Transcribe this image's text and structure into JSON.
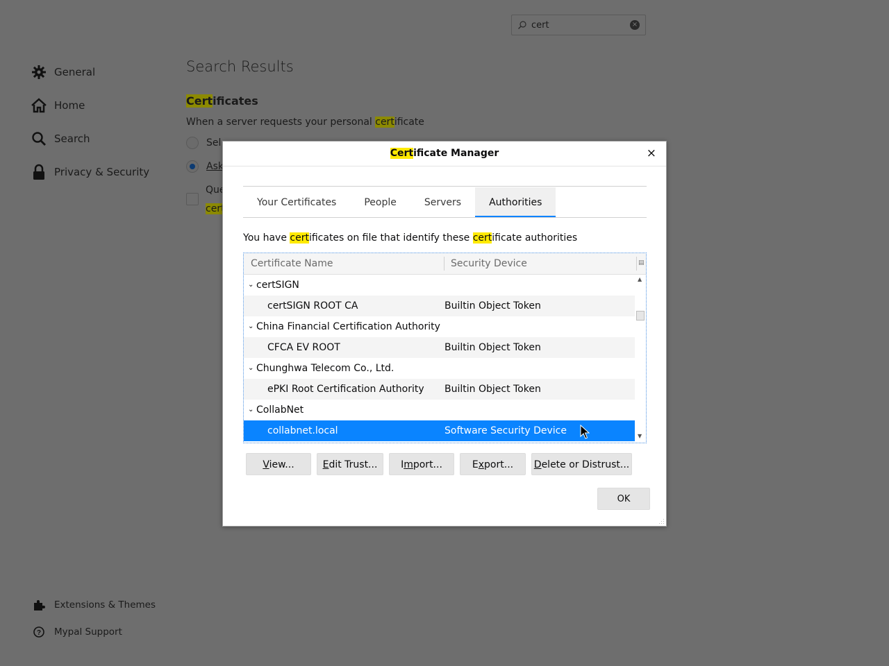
{
  "search": {
    "value": "cert",
    "clear_icon": "clear-icon"
  },
  "nav": {
    "items": [
      {
        "label": "General",
        "icon": "gear-icon"
      },
      {
        "label": "Home",
        "icon": "home-icon"
      },
      {
        "label": "Search",
        "icon": "search-icon"
      },
      {
        "label": "Privacy & Security",
        "icon": "lock-icon"
      }
    ],
    "bottom": [
      {
        "label": "Extensions & Themes",
        "icon": "puzzle-icon"
      },
      {
        "label": "Mypal Support",
        "icon": "help-icon"
      }
    ]
  },
  "results": {
    "title": "Search Results",
    "section_pre": "Cert",
    "section_post": "ificates",
    "desc_pre": "When a server requests your personal ",
    "desc_hl": "cert",
    "desc_post": "ificate",
    "peek_select": "Sel",
    "peek_ask": "Ask",
    "peek_query": "Que",
    "peek_cert": "cert"
  },
  "dialog": {
    "title_hl": "Cert",
    "title_rest": "ificate Manager",
    "close": "×",
    "tabs": [
      "Your Certificates",
      "People",
      "Servers",
      "Authorities"
    ],
    "active_tab": "Authorities",
    "intro_1": "You have ",
    "intro_hl1": "cert",
    "intro_2": "ificates on file that identify these ",
    "intro_hl2": "cert",
    "intro_3": "ificate authorities",
    "columns": [
      "Certificate Name",
      "Security Device"
    ],
    "rows": [
      {
        "type": "group",
        "name": "certSIGN"
      },
      {
        "type": "cert",
        "name": "certSIGN ROOT CA",
        "device": "Builtin Object Token"
      },
      {
        "type": "group",
        "name": "China Financial Certification Authority"
      },
      {
        "type": "cert",
        "name": "CFCA EV ROOT",
        "device": "Builtin Object Token"
      },
      {
        "type": "group",
        "name": "Chunghwa Telecom Co., Ltd."
      },
      {
        "type": "cert",
        "name": "ePKI Root Certification Authority",
        "device": "Builtin Object Token"
      },
      {
        "type": "group",
        "name": "CollabNet"
      },
      {
        "type": "cert",
        "name": "collabnet.local",
        "device": "Software Security Device",
        "selected": true
      }
    ],
    "buttons": {
      "view_u": "V",
      "view_rest": "iew...",
      "edit_u": "E",
      "edit_rest": "dit Trust...",
      "import_pre": "I",
      "import_u": "m",
      "import_rest": "port...",
      "export_u": "x",
      "export_pre": "E",
      "export_rest": "port...",
      "delete_u": "D",
      "delete_rest": "elete or Distrust...",
      "ok": "OK"
    }
  },
  "colors": {
    "accent": "#0a84ff",
    "highlight": "#ffea00",
    "overlay": "#6e6e6e"
  }
}
